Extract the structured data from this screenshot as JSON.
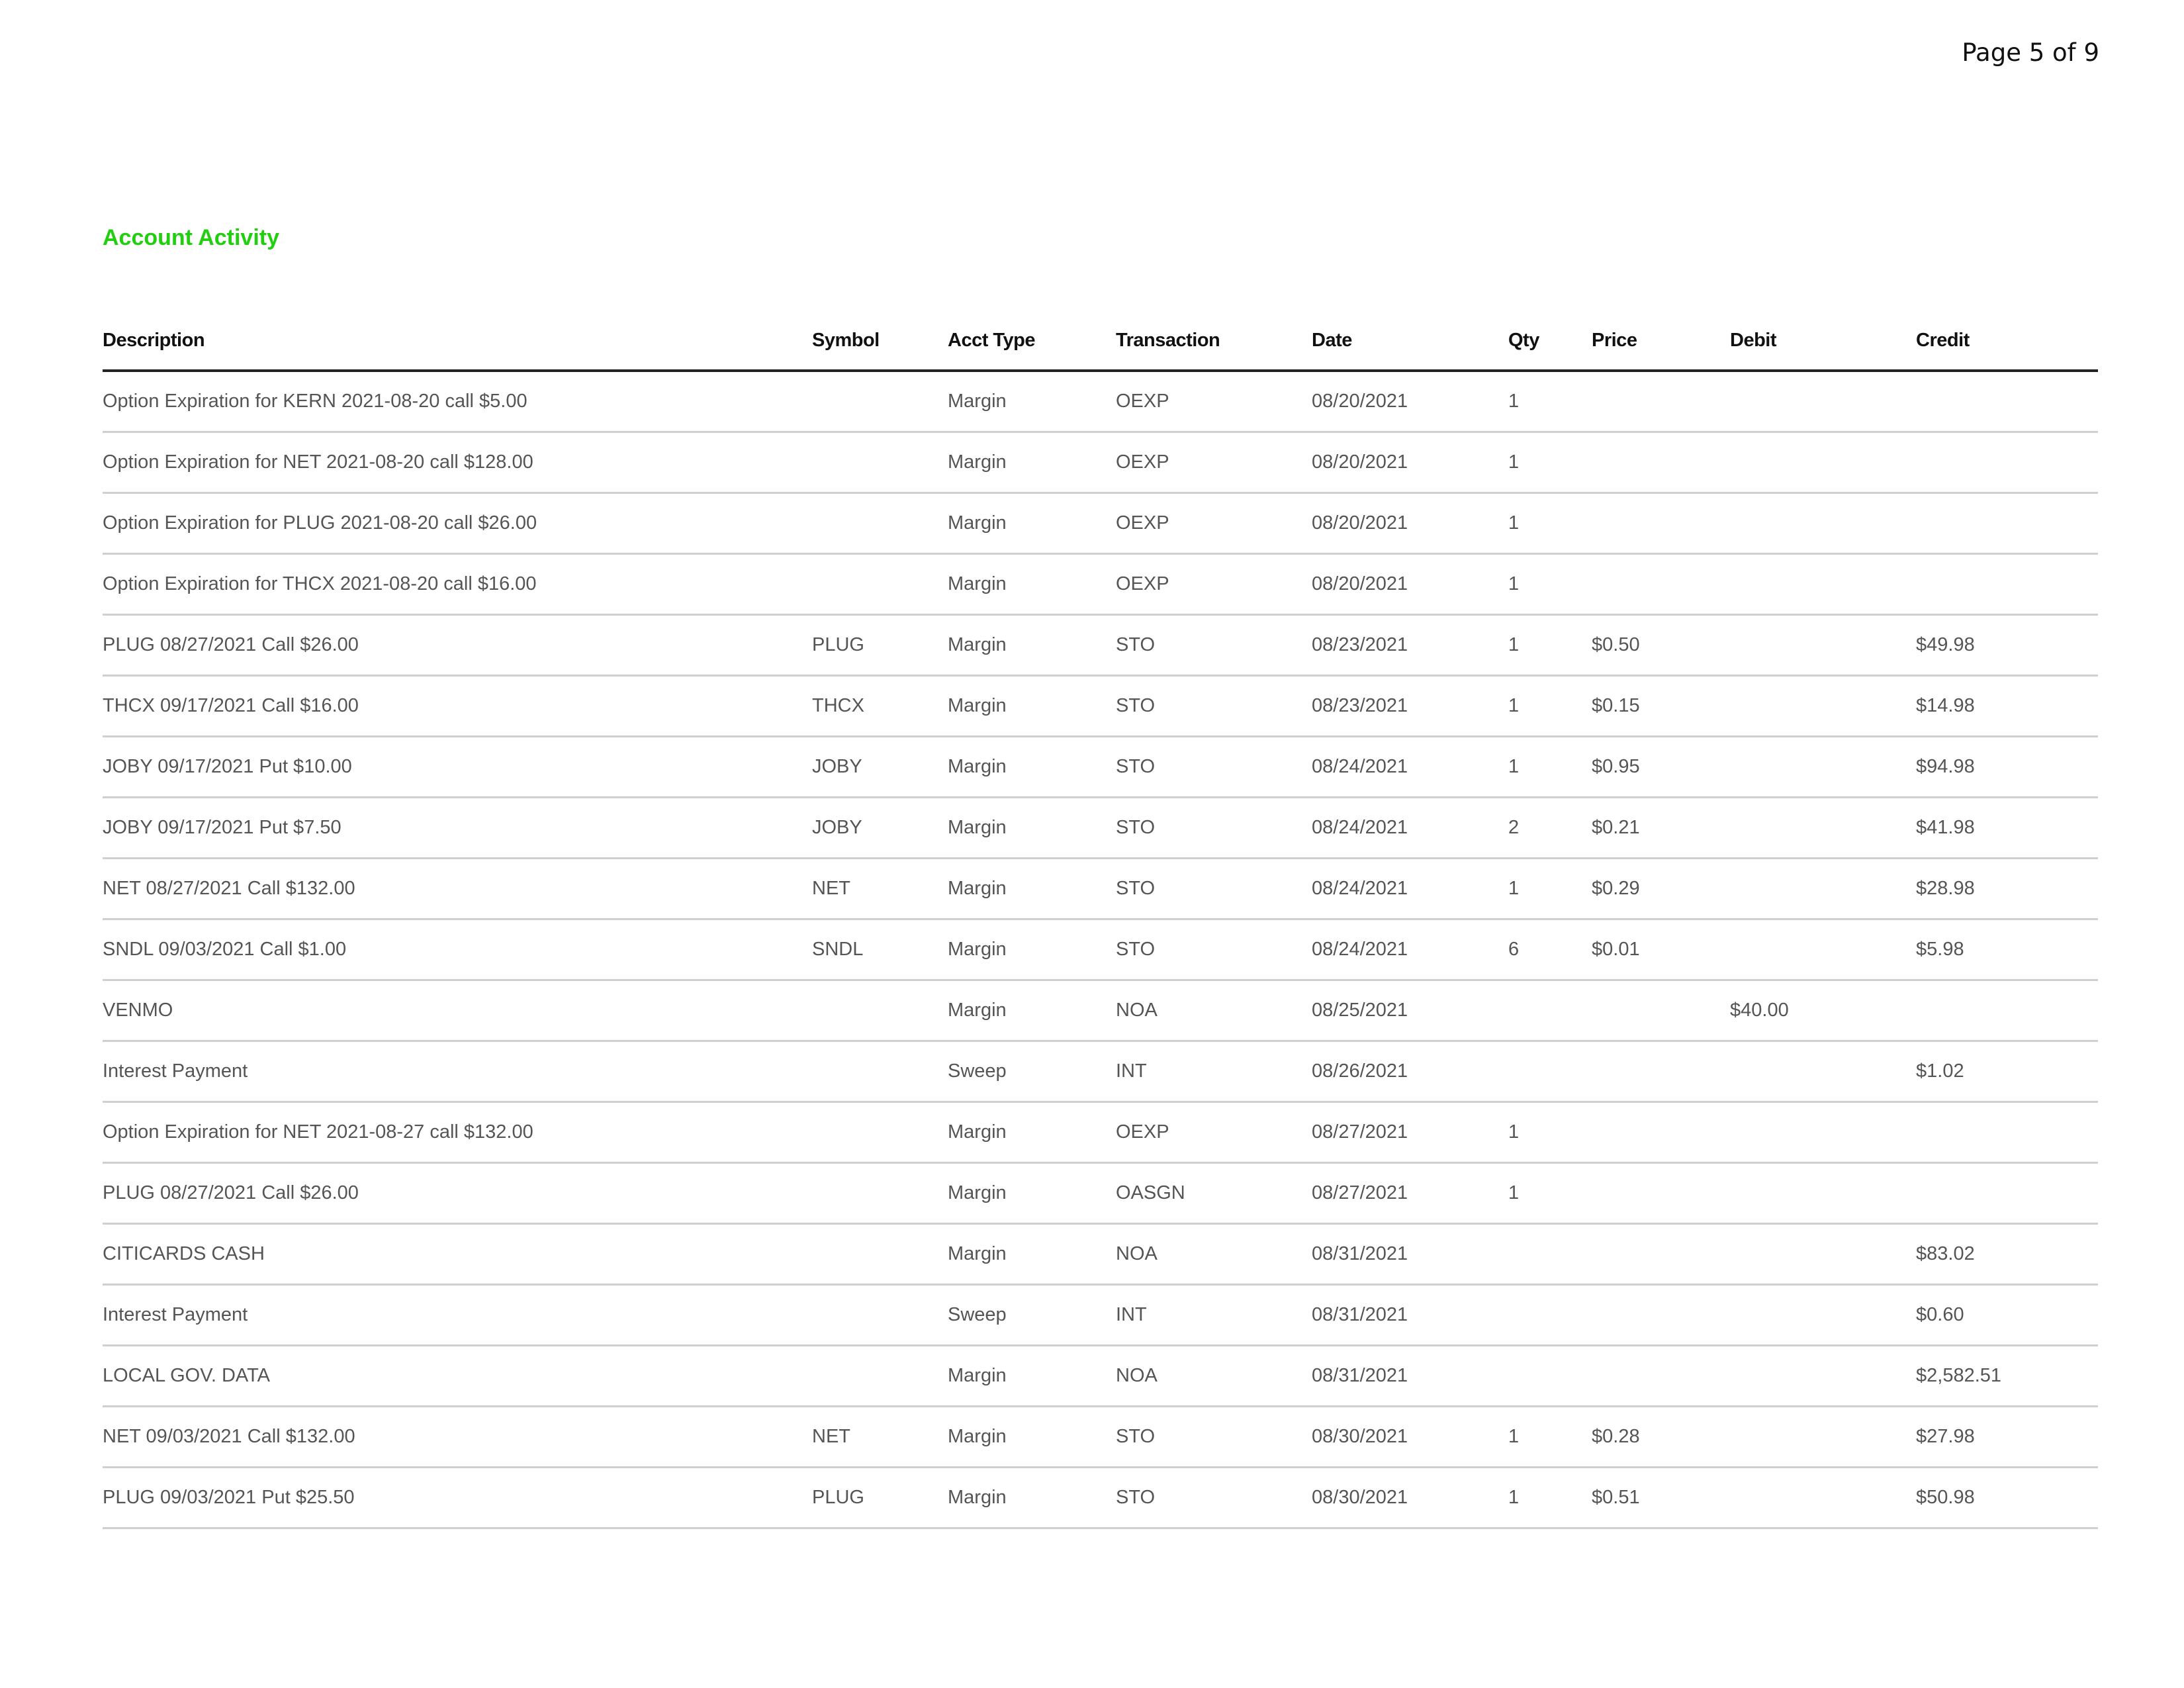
{
  "page_number": "Page 5 of 9",
  "section_title": "Account Activity",
  "table": {
    "headers": {
      "description": "Description",
      "symbol": "Symbol",
      "acct_type": "Acct Type",
      "transaction": "Transaction",
      "date": "Date",
      "qty": "Qty",
      "price": "Price",
      "debit": "Debit",
      "credit": "Credit"
    },
    "rows": [
      {
        "description": "Option Expiration for KERN 2021-08-20 call $5.00",
        "symbol": "",
        "acct_type": "Margin",
        "transaction": "OEXP",
        "date": "08/20/2021",
        "qty": "1",
        "price": "",
        "debit": "",
        "credit": ""
      },
      {
        "description": "Option Expiration for NET 2021-08-20 call $128.00",
        "symbol": "",
        "acct_type": "Margin",
        "transaction": "OEXP",
        "date": "08/20/2021",
        "qty": "1",
        "price": "",
        "debit": "",
        "credit": ""
      },
      {
        "description": "Option Expiration for PLUG 2021-08-20 call $26.00",
        "symbol": "",
        "acct_type": "Margin",
        "transaction": "OEXP",
        "date": "08/20/2021",
        "qty": "1",
        "price": "",
        "debit": "",
        "credit": ""
      },
      {
        "description": "Option Expiration for THCX 2021-08-20 call $16.00",
        "symbol": "",
        "acct_type": "Margin",
        "transaction": "OEXP",
        "date": "08/20/2021",
        "qty": "1",
        "price": "",
        "debit": "",
        "credit": ""
      },
      {
        "description": "PLUG 08/27/2021 Call $26.00",
        "symbol": "PLUG",
        "acct_type": "Margin",
        "transaction": "STO",
        "date": "08/23/2021",
        "qty": "1",
        "price": "$0.50",
        "debit": "",
        "credit": "$49.98"
      },
      {
        "description": "THCX 09/17/2021 Call $16.00",
        "symbol": "THCX",
        "acct_type": "Margin",
        "transaction": "STO",
        "date": "08/23/2021",
        "qty": "1",
        "price": "$0.15",
        "debit": "",
        "credit": "$14.98"
      },
      {
        "description": "JOBY 09/17/2021 Put $10.00",
        "symbol": "JOBY",
        "acct_type": "Margin",
        "transaction": "STO",
        "date": "08/24/2021",
        "qty": "1",
        "price": "$0.95",
        "debit": "",
        "credit": "$94.98"
      },
      {
        "description": "JOBY 09/17/2021 Put $7.50",
        "symbol": "JOBY",
        "acct_type": "Margin",
        "transaction": "STO",
        "date": "08/24/2021",
        "qty": "2",
        "price": "$0.21",
        "debit": "",
        "credit": "$41.98"
      },
      {
        "description": "NET 08/27/2021 Call $132.00",
        "symbol": "NET",
        "acct_type": "Margin",
        "transaction": "STO",
        "date": "08/24/2021",
        "qty": "1",
        "price": "$0.29",
        "debit": "",
        "credit": "$28.98"
      },
      {
        "description": "SNDL 09/03/2021 Call $1.00",
        "symbol": "SNDL",
        "acct_type": "Margin",
        "transaction": "STO",
        "date": "08/24/2021",
        "qty": "6",
        "price": "$0.01",
        "debit": "",
        "credit": "$5.98"
      },
      {
        "description": "VENMO",
        "symbol": "",
        "acct_type": "Margin",
        "transaction": "NOA",
        "date": "08/25/2021",
        "qty": "",
        "price": "",
        "debit": "$40.00",
        "credit": ""
      },
      {
        "description": "Interest Payment",
        "symbol": "",
        "acct_type": "Sweep",
        "transaction": "INT",
        "date": "08/26/2021",
        "qty": "",
        "price": "",
        "debit": "",
        "credit": "$1.02"
      },
      {
        "description": "Option Expiration for NET 2021-08-27 call $132.00",
        "symbol": "",
        "acct_type": "Margin",
        "transaction": "OEXP",
        "date": "08/27/2021",
        "qty": "1",
        "price": "",
        "debit": "",
        "credit": ""
      },
      {
        "description": "PLUG 08/27/2021 Call $26.00",
        "symbol": "",
        "acct_type": "Margin",
        "transaction": "OASGN",
        "date": "08/27/2021",
        "qty": "1",
        "price": "",
        "debit": "",
        "credit": ""
      },
      {
        "description": "CITICARDS CASH",
        "symbol": "",
        "acct_type": "Margin",
        "transaction": "NOA",
        "date": "08/31/2021",
        "qty": "",
        "price": "",
        "debit": "",
        "credit": "$83.02"
      },
      {
        "description": "Interest Payment",
        "symbol": "",
        "acct_type": "Sweep",
        "transaction": "INT",
        "date": "08/31/2021",
        "qty": "",
        "price": "",
        "debit": "",
        "credit": "$0.60"
      },
      {
        "description": "LOCAL GOV. DATA",
        "symbol": "",
        "acct_type": "Margin",
        "transaction": "NOA",
        "date": "08/31/2021",
        "qty": "",
        "price": "",
        "debit": "",
        "credit": "$2,582.51"
      },
      {
        "description": "NET 09/03/2021 Call $132.00",
        "symbol": "NET",
        "acct_type": "Margin",
        "transaction": "STO",
        "date": "08/30/2021",
        "qty": "1",
        "price": "$0.28",
        "debit": "",
        "credit": "$27.98"
      },
      {
        "description": "PLUG 09/03/2021 Put $25.50",
        "symbol": "PLUG",
        "acct_type": "Margin",
        "transaction": "STO",
        "date": "08/30/2021",
        "qty": "1",
        "price": "$0.51",
        "debit": "",
        "credit": "$50.98"
      }
    ]
  }
}
